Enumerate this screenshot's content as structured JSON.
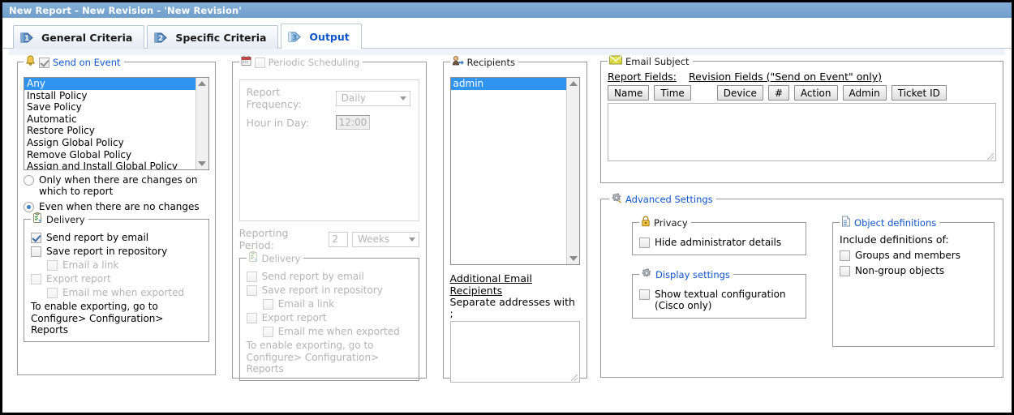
{
  "window": {
    "title": "New Report - New Revision - 'New Revision'"
  },
  "tabs": [
    {
      "number": "1",
      "label": "General Criteria",
      "active": false,
      "icon": "numbered-arrow-icon"
    },
    {
      "number": "2",
      "label": "Specific Criteria",
      "active": false,
      "icon": "numbered-arrow-icon"
    },
    {
      "number": "3",
      "label": "Output",
      "active": true,
      "icon": "numbered-arrow-icon"
    }
  ],
  "send_on_event": {
    "legend": "Send on Event",
    "legend_icon": "bell-icon",
    "checked": true,
    "events": [
      "Any",
      "Install Policy",
      "Save Policy",
      "Automatic",
      "Restore Policy",
      "Assign Global Policy",
      "Remove Global Policy",
      "Assign and Install Global Policy"
    ],
    "selected_event": "Any",
    "radios": [
      {
        "label": "Only when there are changes on which to report",
        "selected": false
      },
      {
        "label": "Even when there are no changes",
        "selected": true
      }
    ],
    "delivery": {
      "legend": "Delivery",
      "legend_icon": "clipboard-icon",
      "options": [
        {
          "label": "Send report by email",
          "checked": true,
          "disabled": false,
          "indent": false
        },
        {
          "label": "Save report in repository",
          "checked": false,
          "disabled": false,
          "indent": false
        },
        {
          "label": "Email a link",
          "checked": false,
          "disabled": true,
          "indent": true
        },
        {
          "label": "Export report",
          "checked": false,
          "disabled": true,
          "indent": false
        },
        {
          "label": "Email me when exported",
          "checked": false,
          "disabled": true,
          "indent": true
        }
      ],
      "note_line1": "To enable exporting, go to",
      "note_line2": "Configure> Configuration> Reports",
      "note_disabled": false
    }
  },
  "periodic_scheduling": {
    "legend": "Periodic Scheduling",
    "legend_icon": "calendar-icon",
    "checked": false,
    "disabled": true,
    "frequency_label": "Report Frequency:",
    "frequency_value": "Daily",
    "hour_label": "Hour in Day:",
    "hour_value": "12:00",
    "reporting_period_label": "Reporting Period:",
    "reporting_period_value": "2",
    "reporting_period_unit": "Weeks",
    "delivery": {
      "legend": "Delivery",
      "legend_icon": "clipboard-icon",
      "options": [
        {
          "label": "Send report by email",
          "checked": false,
          "disabled": true,
          "indent": false
        },
        {
          "label": "Save report in repository",
          "checked": false,
          "disabled": true,
          "indent": false
        },
        {
          "label": "Email a link",
          "checked": false,
          "disabled": true,
          "indent": true
        },
        {
          "label": "Export report",
          "checked": false,
          "disabled": true,
          "indent": false
        },
        {
          "label": "Email me when exported",
          "checked": false,
          "disabled": true,
          "indent": true
        }
      ],
      "note_line1": "To enable exporting, go to",
      "note_line2": "Configure> Configuration> Reports",
      "note_disabled": true
    }
  },
  "recipients": {
    "legend": "Recipients",
    "legend_icon": "user-arrow-icon",
    "items": [
      "admin"
    ],
    "selected": "admin",
    "additional_title": "Additional Email Recipients",
    "additional_subtitle": "Separate addresses with ;",
    "additional_value": ""
  },
  "email_subject": {
    "legend": "Email Subject",
    "legend_icon": "envelope-icon",
    "report_fields_label": "Report Fields:",
    "revision_fields_label": "Revision Fields (\"Send on Event\" only)",
    "report_field_buttons": [
      "Name",
      "Time"
    ],
    "revision_field_buttons": [
      "Device",
      "#",
      "Action",
      "Admin",
      "Ticket ID"
    ],
    "subject_value": ""
  },
  "advanced_settings": {
    "legend": "Advanced Settings",
    "legend_icon": "gear-icon",
    "privacy": {
      "legend": "Privacy",
      "legend_icon": "lock-icon",
      "options": [
        {
          "label": "Hide administrator details",
          "checked": false
        }
      ]
    },
    "display_settings": {
      "legend": "Display settings",
      "legend_icon": "gear-icon",
      "options": [
        {
          "label_line1": "Show textual configuration",
          "label_line2": "(Cisco only)",
          "checked": false
        }
      ]
    },
    "object_definitions": {
      "legend": "Object definitions",
      "legend_icon": "document-icon",
      "head": "Include definitions of:",
      "options": [
        {
          "label": "Groups and members",
          "checked": false
        },
        {
          "label": "Non-group objects",
          "checked": false
        }
      ]
    }
  },
  "colors": {
    "titlebar": "#7ba7d1",
    "link": "#1155cc",
    "selection": "#2f93f0",
    "disabled_text": "#b4b4b4",
    "border": "#9a9a9a"
  }
}
